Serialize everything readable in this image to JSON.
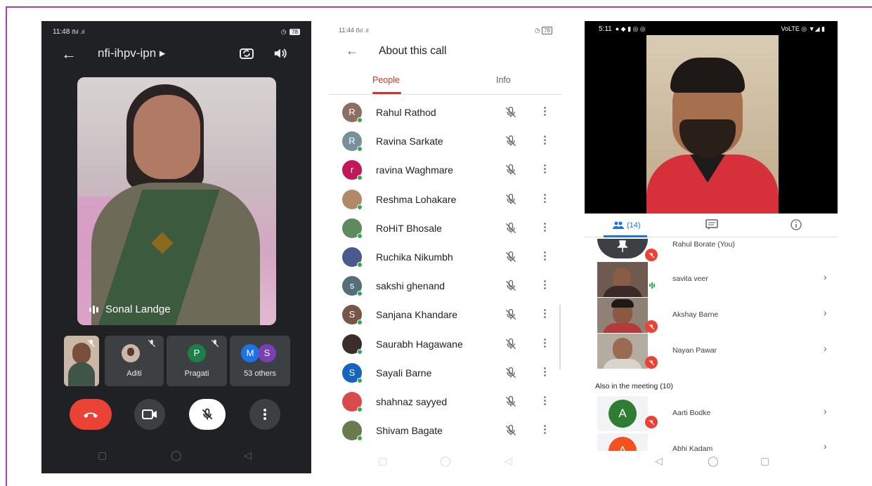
{
  "panel1": {
    "time": "11:48",
    "signal": "ẞıl .ıl",
    "battery": "78",
    "title": "nfi-ihpv-ipn ▸",
    "main_speaker": "Sonal Landge",
    "tiles": [
      {
        "label": "Aditi"
      },
      {
        "label": "Pragati",
        "initial": "P"
      },
      {
        "label": "53 others",
        "initials": [
          "M",
          "S"
        ]
      }
    ]
  },
  "panel2": {
    "time": "11:44",
    "signal": "ẞıl .ıl",
    "battery": "78",
    "heading": "About this call",
    "tab_people": "People",
    "tab_info": "Info",
    "people": [
      {
        "name": "Rahul Rathod",
        "initial": "R",
        "color": "#8d6e63"
      },
      {
        "name": "Ravina Sarkate",
        "initial": "R",
        "color": "#78909c"
      },
      {
        "name": "ravina Waghmare",
        "initial": "r",
        "color": "#c2185b"
      },
      {
        "name": "Reshma Lohakare",
        "initial": "",
        "color": "#b08968"
      },
      {
        "name": "RoHiT Bhosale",
        "initial": "",
        "color": "#5d8a5e"
      },
      {
        "name": "Ruchika Nikumbh",
        "initial": "",
        "color": "#4a5a8c"
      },
      {
        "name": "sakshi ghenand",
        "initial": "s",
        "color": "#546e7a"
      },
      {
        "name": "Sanjana Khandare",
        "initial": "S",
        "color": "#795548"
      },
      {
        "name": "Saurabh Hagawane",
        "initial": "",
        "color": "#3a2d2b"
      },
      {
        "name": "Sayali Barne",
        "initial": "S",
        "color": "#1565c0"
      },
      {
        "name": "shahnaz sayyed",
        "initial": "",
        "color": "#d94b4b"
      },
      {
        "name": "Shivam Bagate",
        "initial": "",
        "color": "#6b7a4e"
      }
    ]
  },
  "panel3": {
    "time": "5:11",
    "status_right": "VoLTE ◎ ▼◢ ▮",
    "people_count": "(14)",
    "participants": [
      {
        "name": "Rahul Borate (You)"
      },
      {
        "name": "savita veer"
      },
      {
        "name": "Akshay Barne"
      },
      {
        "name": "Nayan Pawar"
      }
    ],
    "also_heading": "Also in the meeting (10)",
    "also": [
      {
        "name": "Aarti Bodke",
        "initial": "A",
        "color": "#2e7d32"
      },
      {
        "name": "Abhi Kadam",
        "initial": "A",
        "color": "#f4511e"
      }
    ]
  },
  "colors": {
    "frame": "#a641a7",
    "hangup": "#ea4335",
    "active_tab": "#d93025",
    "accent": "#1a73e8"
  }
}
